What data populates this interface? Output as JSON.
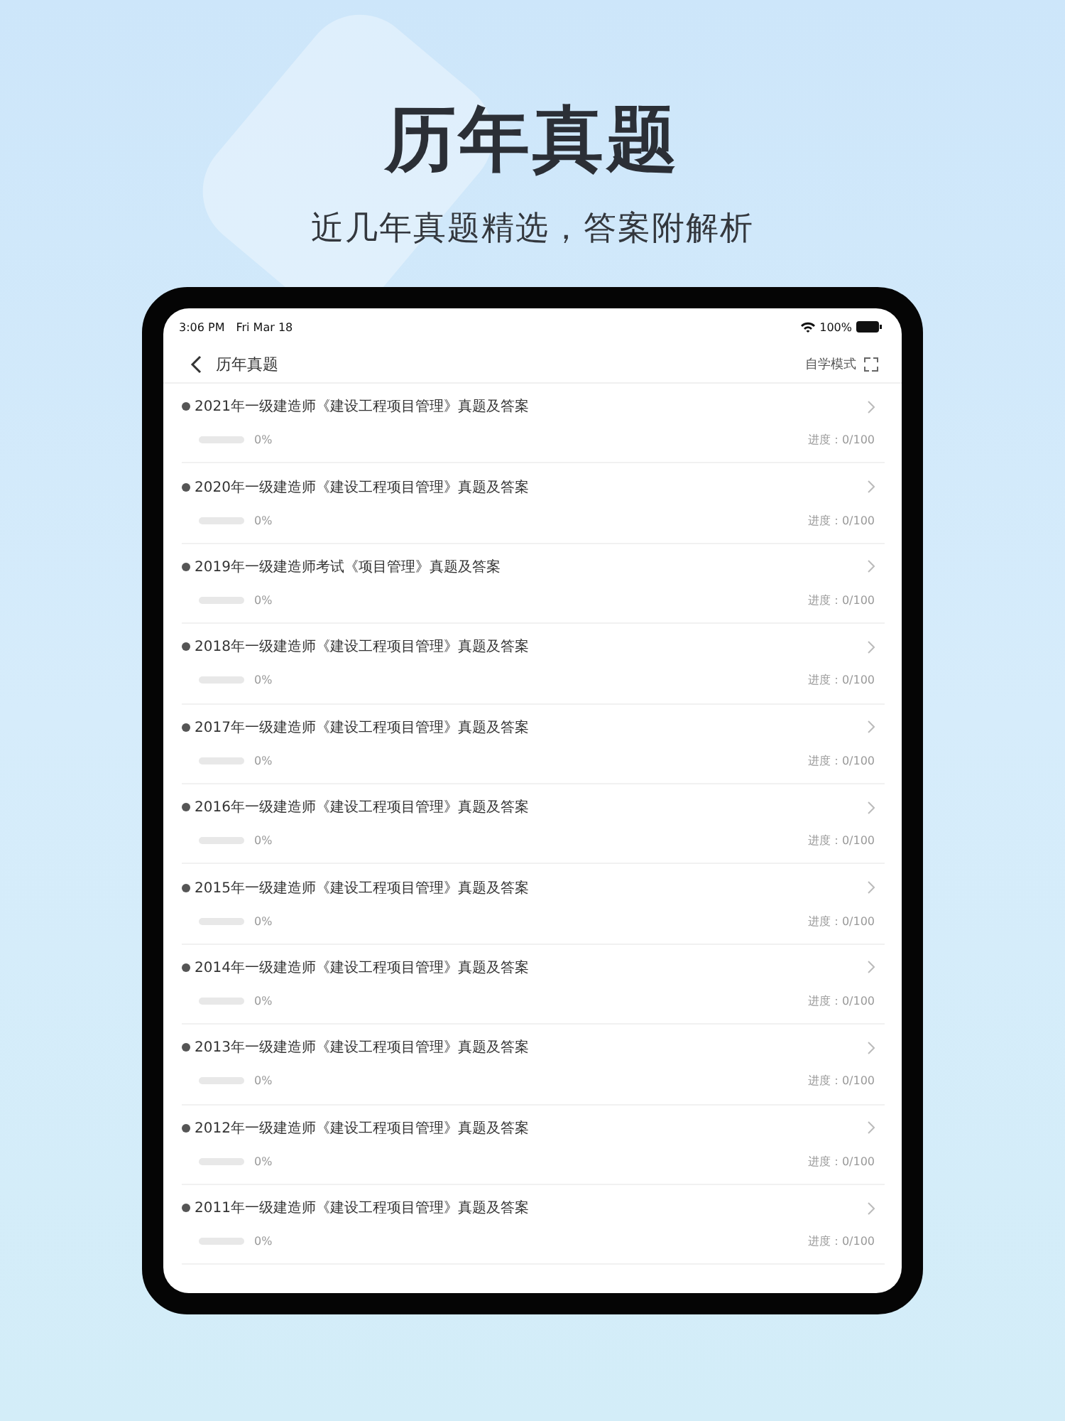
{
  "headline": "历年真题",
  "subtitle": "近几年真题精选，答案附解析",
  "status_bar": {
    "time": "3:06 PM",
    "date": "Fri Mar 18",
    "battery": "100%"
  },
  "nav": {
    "title": "历年真题",
    "mode_label": "自学模式"
  },
  "items": [
    {
      "title": "2021年一级建造师《建设工程项目管理》真题及答案",
      "level": 0,
      "percent": "0%",
      "progress": "进度：0/100"
    },
    {
      "title": "2020年一级建造师《建设工程项目管理》真题及答案",
      "level": 0,
      "percent": "0%",
      "progress": "进度：0/100"
    },
    {
      "title": "2019年一级建造师考试《项目管理》真题及答案",
      "level": 0,
      "percent": "0%",
      "progress": "进度：0/100"
    },
    {
      "title": "2018年一级建造师《建设工程项目管理》真题及答案",
      "level": 0,
      "percent": "0%",
      "progress": "进度：0/100"
    },
    {
      "title": "2017年一级建造师《建设工程项目管理》真题及答案",
      "level": 0,
      "percent": "0%",
      "progress": "进度：0/100"
    },
    {
      "title": "2016年一级建造师《建设工程项目管理》真题及答案",
      "level": 0,
      "percent": "0%",
      "progress": "进度：0/100"
    },
    {
      "title": "2015年一级建造师《建设工程项目管理》真题及答案",
      "level": 0,
      "percent": "0%",
      "progress": "进度：0/100"
    },
    {
      "title": "2014年一级建造师《建设工程项目管理》真题及答案",
      "level": 0,
      "percent": "0%",
      "progress": "进度：0/100"
    },
    {
      "title": "2013年一级建造师《建设工程项目管理》真题及答案",
      "level": 0,
      "percent": "0%",
      "progress": "进度：0/100"
    },
    {
      "title": "2012年一级建造师《建设工程项目管理》真题及答案",
      "level": 0,
      "percent": "0%",
      "progress": "进度：0/100"
    },
    {
      "title": "2011年一级建造师《建设工程项目管理》真题及答案",
      "level": 0,
      "percent": "0%",
      "progress": "进度：0/100"
    }
  ]
}
